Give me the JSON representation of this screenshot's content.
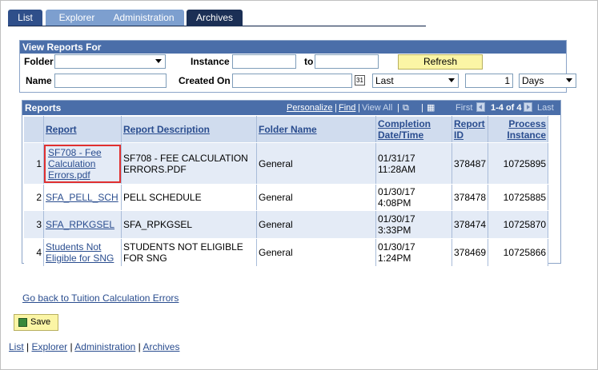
{
  "tabs": [
    "List",
    "Explorer",
    "Administration",
    "Archives"
  ],
  "view_reports": {
    "title": "View Reports For",
    "folder_label": "Folder",
    "folder_value": "",
    "instance_label": "Instance",
    "instance_from": "",
    "to_label": "to",
    "instance_to": "",
    "refresh_label": "Refresh",
    "name_label": "Name",
    "name_value": "",
    "created_on_label": "Created On",
    "created_on_value": "",
    "last_select": "Last",
    "last_count": "1",
    "unit_select": "Days"
  },
  "reports": {
    "title": "Reports",
    "personalize": "Personalize",
    "find": "Find",
    "view_all": "View All",
    "first": "First",
    "range": "1-4 of 4",
    "last": "Last",
    "columns": [
      "Report",
      "Report Description",
      "Folder Name",
      "Completion Date/Time",
      "Report ID",
      "Process Instance"
    ],
    "rows": [
      {
        "n": "1",
        "report": "SF708 - Fee Calculation Errors.pdf",
        "desc": "SF708 - FEE CALCULATION ERRORS.PDF",
        "folder": "General",
        "date": "01/31/17",
        "time": "11:28AM",
        "id": "378487",
        "instance": "10725895"
      },
      {
        "n": "2",
        "report": "SFA_PELL_SCH",
        "desc": "PELL SCHEDULE",
        "folder": "General",
        "date": "01/30/17",
        "time": "4:08PM",
        "id": "378478",
        "instance": "10725885"
      },
      {
        "n": "3",
        "report": "SFA_RPKGSEL",
        "desc": "SFA_RPKGSEL",
        "folder": "General",
        "date": "01/30/17",
        "time": "3:33PM",
        "id": "378474",
        "instance": "10725870"
      },
      {
        "n": "4",
        "report": "Students Not Eligible for SNG",
        "desc": "STUDENTS NOT ELIGIBLE FOR SNG",
        "folder": "General",
        "date": "01/30/17",
        "time": "1:24PM",
        "id": "378469",
        "instance": "10725866"
      }
    ]
  },
  "back_link": "Go back to Tuition Calculation Errors",
  "save_label": "Save",
  "footer": [
    "List",
    "Explorer",
    "Administration",
    "Archives"
  ],
  "colors": {
    "header_blue": "#4a6ea9",
    "tab_dark": "#1b2f55",
    "link": "#2a4d8f",
    "button_yellow": "#fbf5a5",
    "highlight_red": "#e03030"
  }
}
